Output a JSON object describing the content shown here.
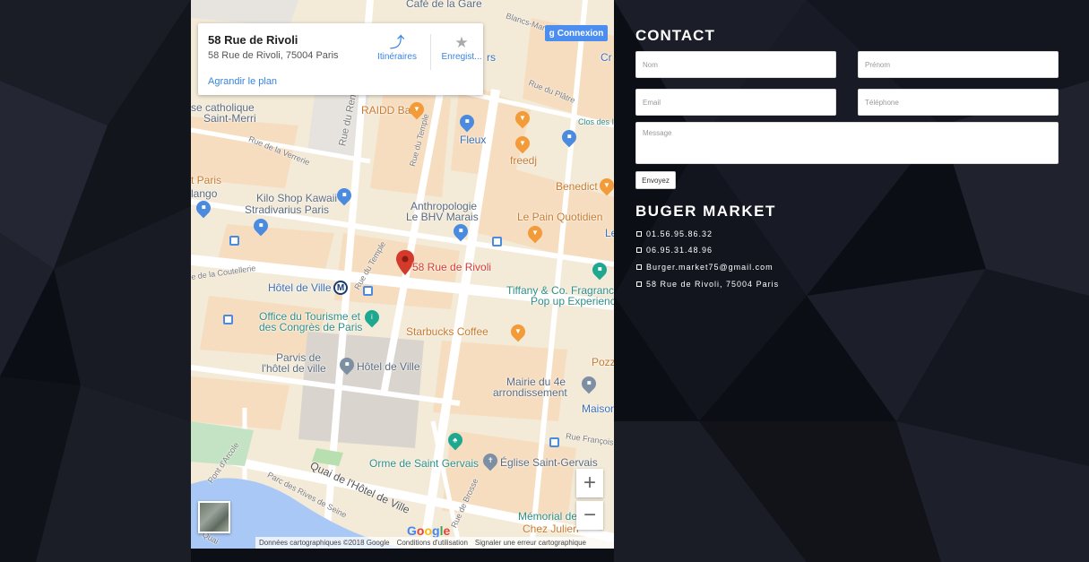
{
  "map": {
    "info_title": "58 Rue de Rivoli",
    "info_address": "58 Rue de Rivoli, 75004 Paris",
    "enlarge_link": "Agrandir le plan",
    "directions_label": "Itinéraires",
    "save_label": "Enregist...",
    "signin_label": "Connexion",
    "zoom_in": "+",
    "zoom_out": "−",
    "google": "Google",
    "footer": {
      "data": "Données cartographiques ©2018 Google",
      "terms": "Conditions d'utilisation",
      "report": "Signaler une erreur cartographique"
    },
    "marker_label": "58 Rue de Rivoli",
    "labels": {
      "cafe_gare": "Café de la Gare",
      "blancs": "Blancs-Manteaux",
      "rs": "rs",
      "cr": "Cr",
      "plante": "Rue du Plâtre",
      "se_catholique": "se catholique",
      "saint_merri": "Saint-Merri",
      "raidd": "RAIDD Bar",
      "clos_des": "Clos des I",
      "rue_renard": "Rue du Renard",
      "rue_temple": "Rue du Temple",
      "fleux": "Fleux",
      "freedj": "freedj",
      "verrerie": "Rue de la Verrerie",
      "benedict": "Benedict",
      "t_paris": "t Paris",
      "lango": "lango",
      "kilo": "Kilo Shop Kawaii",
      "stradivarius": "Stradivarius Paris",
      "anthropologie": "Anthropologie",
      "bhv": "Le BHV Marais",
      "pain": "Le Pain Quotidien",
      "le": "Le",
      "coutellerie": "e de la Coutellerie",
      "hotel_ville": "Hôtel de Ville",
      "metro": "M",
      "tiffany": "Tiffany & Co. Fragrance",
      "popup": "Pop up Experience",
      "office_tourisme": "Office du Tourisme et",
      "congres": "des Congrès de Paris",
      "starbucks": "Starbucks Coffee",
      "parvis": "Parvis de",
      "hotel_ville2": "l'hôtel de ville",
      "hotel_ville3": "Hôtel de Ville",
      "pozz": "Pozz",
      "mairie": "Mairie du 4e",
      "arrondissement": "arrondissement",
      "maison": "Maison",
      "rue_francois": "Rue François",
      "orme": "Orme de Saint Gervais",
      "eglise": "Église Saint-Gervais",
      "pont_arcole": "Pont d'Arcole",
      "quai_hotel": "Quai de l'Hôtel de Ville",
      "parc_rives": "Parc des Rives de Seine",
      "memorial": "Mémorial de",
      "chez_julien": "Chez Julien",
      "quai": "Quai",
      "rue_brosse": "Rue de Brosse"
    }
  },
  "contact": {
    "title": "CONTACT",
    "nom_placeholder": "Nom",
    "prenom_placeholder": "Prénom",
    "email_placeholder": "Email",
    "telephone_placeholder": "Téléphone",
    "message_placeholder": "Message",
    "send_label": "Envoyez"
  },
  "market": {
    "title": "BUGER MARKET",
    "phone1": "01.56.95.86.32",
    "phone2": "06.95.31.48.96",
    "email": "Burger.market75@gmail.com",
    "address": "58 Rue de Rivoli, 75004 Paris"
  },
  "colors": {
    "background": "#0b0d14",
    "map_accent_blue": "#4a8be0",
    "map_marker_red": "#d33a2c"
  }
}
